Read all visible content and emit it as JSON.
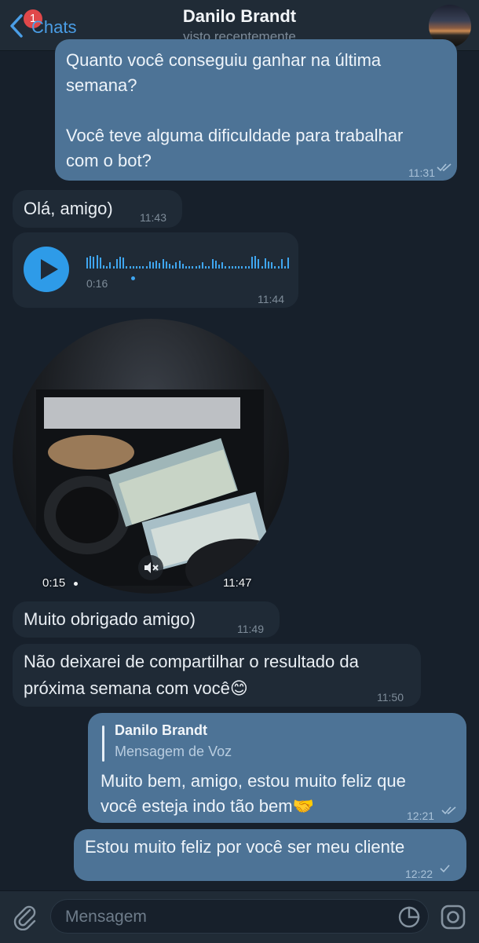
{
  "header": {
    "back_label": "Chats",
    "badge_count": "1",
    "contact_name": "Danilo Brandt",
    "status": "visto recentemente"
  },
  "messages": {
    "m1": {
      "line1": "Quanto você conseguiu ganhar na última",
      "line2": "semana?",
      "line3": "Você teve alguma dificuldade para trabalhar",
      "line4": "com o bot?",
      "time": "11:31"
    },
    "m2": {
      "text": "Olá, amigo)",
      "time": "11:43"
    },
    "m3": {
      "duration": "0:16",
      "time": "11:44"
    },
    "m4": {
      "duration": "0:15",
      "time": "11:47"
    },
    "m5": {
      "text": "Muito obrigado amigo)",
      "time": "11:49"
    },
    "m6": {
      "line1": "Não deixarei de compartilhar o resultado da",
      "line2": "próxima semana com você😊",
      "time": "11:50"
    },
    "m7": {
      "reply_name": "Danilo Brandt",
      "reply_text": "Mensagem de Voz",
      "line1": "Muito bem, amigo, estou muito feliz que",
      "line2": "você esteja indo tão bem🤝",
      "time": "12:21"
    },
    "m8": {
      "text": "Estou muito feliz por você ser meu cliente",
      "time": "12:22"
    }
  },
  "input": {
    "placeholder": "Mensagem"
  },
  "colors": {
    "background": "#17202b",
    "incoming": "#1f2a36",
    "outgoing": "#4d7396",
    "accent": "#2e9be8"
  }
}
